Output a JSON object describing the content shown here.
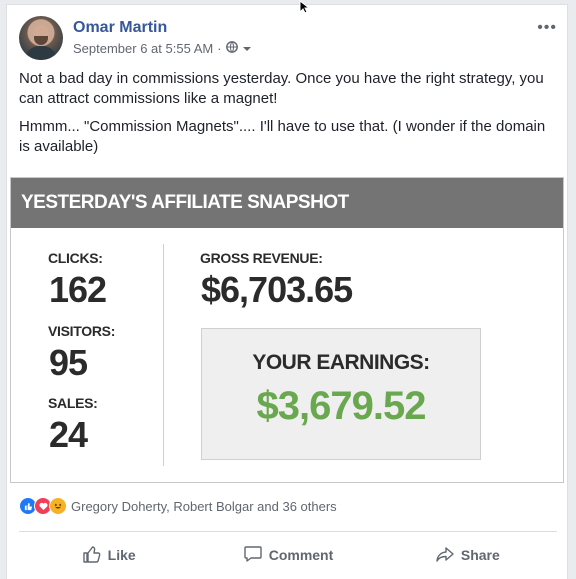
{
  "post": {
    "author": "Omar Martin",
    "timestamp": "September 6 at 5:55 AM",
    "meta_separator": "·",
    "more_label": "•••",
    "paragraphs": [
      "Not a bad day in commissions yesterday. Once you have the right strategy, you can attract commissions like a magnet!",
      "Hmmm... \"Commission Magnets\".... I'll have to use that. (I wonder if the domain is available)"
    ]
  },
  "snapshot": {
    "title": "YESTERDAY'S AFFILIATE SNAPSHOT",
    "clicks_label": "CLICKS:",
    "clicks_value": "162",
    "visitors_label": "VISITORS:",
    "visitors_value": "95",
    "sales_label": "SALES:",
    "sales_value": "24",
    "gross_label": "GROSS REVENUE:",
    "gross_value": "$6,703.65",
    "earnings_label": "YOUR EARNINGS:",
    "earnings_value": "$3,679.52",
    "earnings_color": "#6aa84f"
  },
  "reactions": {
    "icons": [
      "like-icon",
      "love-icon",
      "haha-icon"
    ],
    "text": "Gregory Doherty, Robert Bolgar and 36 others"
  },
  "actions": {
    "like": "Like",
    "comment": "Comment",
    "share": "Share"
  },
  "colors": {
    "author_link": "#365899",
    "like_blue": "#2078f4",
    "love_red": "#f33e58",
    "haha_yellow": "#f7b125"
  }
}
